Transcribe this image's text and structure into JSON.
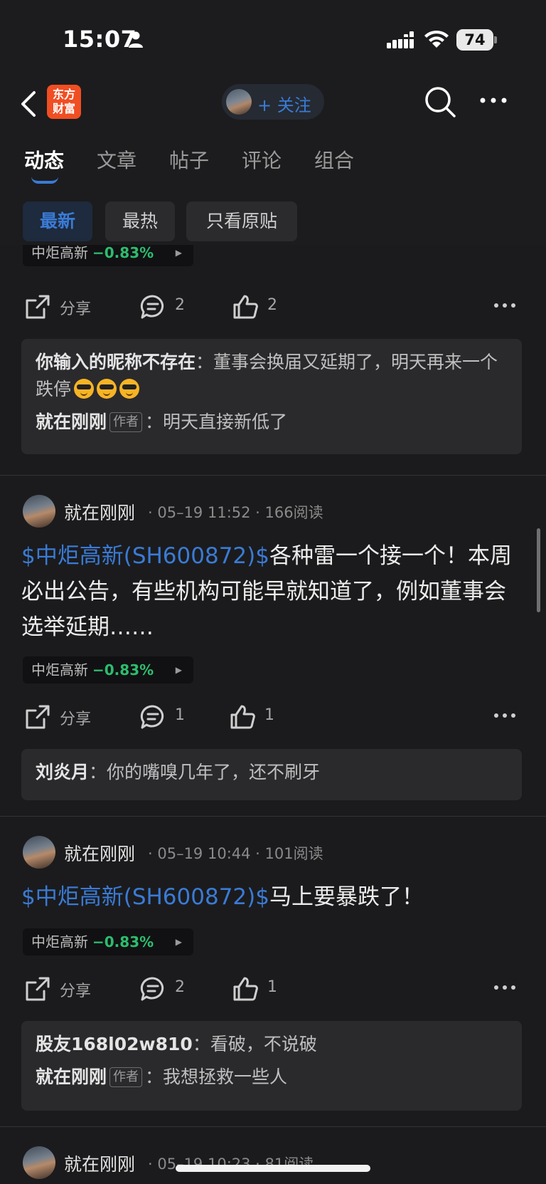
{
  "status_bar": {
    "time": "15:07",
    "battery": "74",
    "battery_level": 0.74
  },
  "nav": {
    "logo_text": "东方\n财富",
    "follow_label": "+ 关注"
  },
  "tabs": [
    {
      "label": "动态",
      "active": true
    },
    {
      "label": "文章",
      "active": false
    },
    {
      "label": "帖子",
      "active": false
    },
    {
      "label": "评论",
      "active": false
    },
    {
      "label": "组合",
      "active": false
    }
  ],
  "filters": [
    {
      "label": "最新",
      "active": true
    },
    {
      "label": "最热",
      "active": false
    },
    {
      "label": "只看原贴",
      "active": false
    }
  ],
  "share_label": "分享",
  "author_badge": "作者",
  "posts": [
    {
      "stock": {
        "name": "中炬高新",
        "change": "−0.83%"
      },
      "comments": "2",
      "likes": "2",
      "replies": [
        {
          "user": "你输入的昵称不存在",
          "text": "董事会换届又延期了，明天再来一个跌停",
          "emoji_count": 3
        },
        {
          "user": "就在刚刚",
          "is_author": true,
          "text": "明天直接新低了"
        }
      ]
    },
    {
      "user": "就在刚刚",
      "meta": "· 05–19 11:52 · 166阅读",
      "cashtag": "$中炬高新(SH600872)$",
      "text": "各种雷一个接一个！本周必出公告，有些机构可能早就知道了，例如董事会选举延期……",
      "stock": {
        "name": "中炬高新",
        "change": "−0.83%"
      },
      "comments": "1",
      "likes": "1",
      "replies": [
        {
          "user": "刘炎月",
          "text": "你的嘴嗅几年了，还不刷牙"
        }
      ]
    },
    {
      "user": "就在刚刚",
      "meta": "· 05–19 10:44 · 101阅读",
      "cashtag": "$中炬高新(SH600872)$",
      "text": "马上要暴跌了！",
      "stock": {
        "name": "中炬高新",
        "change": "−0.83%"
      },
      "comments": "2",
      "likes": "1",
      "replies": [
        {
          "user": "股友168l02w810",
          "text": "看破，不说破"
        },
        {
          "user": "就在刚刚",
          "is_author": true,
          "text": "我想拯救一些人"
        }
      ]
    },
    {
      "user": "就在刚刚",
      "meta": "· 05–19 10:23 · 81阅读"
    }
  ],
  "colors": {
    "accent": "#3a7bd5",
    "down": "#2dbd6e",
    "background": "#1b1b1d",
    "brand": "#f04e23"
  }
}
